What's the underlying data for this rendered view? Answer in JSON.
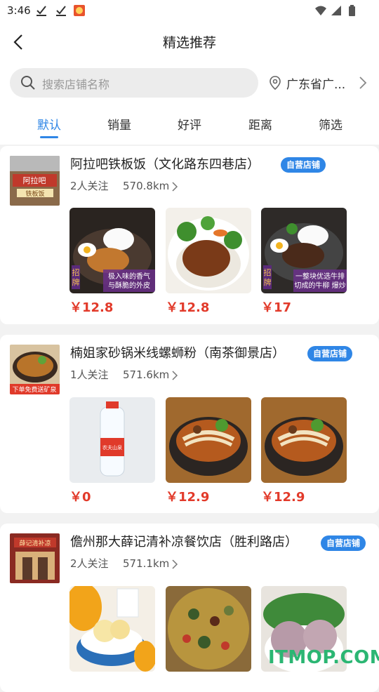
{
  "status": {
    "time": "3:46"
  },
  "header": {
    "title": "精选推荐",
    "back_icon": "back-arrow-icon"
  },
  "search": {
    "placeholder": "搜索店铺名称",
    "location": "广东省广..."
  },
  "tabs": [
    "默认",
    "销量",
    "好评",
    "距离",
    "筛选"
  ],
  "stores": [
    {
      "name": "阿拉吧铁板饭（文化路东四巷店）",
      "badge": "自营店铺",
      "followers": "2人关注",
      "distance": "570.8km",
      "products": [
        {
          "price": "￥12.8",
          "img_text": [
            "招",
            "牌",
            "极入味的香气",
            "与酥脆的外皮"
          ]
        },
        {
          "price": "￥12.8",
          "img_text": []
        },
        {
          "price": "￥17",
          "img_text": [
            "招",
            "牌",
            "一整块优选牛排",
            "切成的牛柳 爆炒"
          ]
        }
      ],
      "logo_text": [
        "阿拉吧",
        "铁板饭"
      ]
    },
    {
      "name": "楠姐家砂锅米线螺蛳粉（南茶御景店）",
      "badge": "自营店铺",
      "followers": "1人关注",
      "distance": "571.6km",
      "products": [
        {
          "price": "￥0",
          "img_text": [
            "农夫山泉"
          ]
        },
        {
          "price": "￥12.9",
          "img_text": []
        },
        {
          "price": "￥12.9",
          "img_text": []
        }
      ],
      "logo_text": [
        "下单免费送矿泉"
      ]
    },
    {
      "name": "儋州那大薛记清补凉餐饮店（胜利路店）",
      "badge": "自营店铺",
      "followers": "2人关注",
      "distance": "571.1km",
      "products": [
        {
          "price": "",
          "img_text": []
        },
        {
          "price": "",
          "img_text": []
        },
        {
          "price": "",
          "img_text": []
        }
      ],
      "logo_text": [
        "薛记清补凉"
      ]
    }
  ],
  "watermark": "ITMOP.COM",
  "colors": {
    "accent": "#2f86e6",
    "price": "#e23a2a",
    "badge": "#2f86e6"
  }
}
